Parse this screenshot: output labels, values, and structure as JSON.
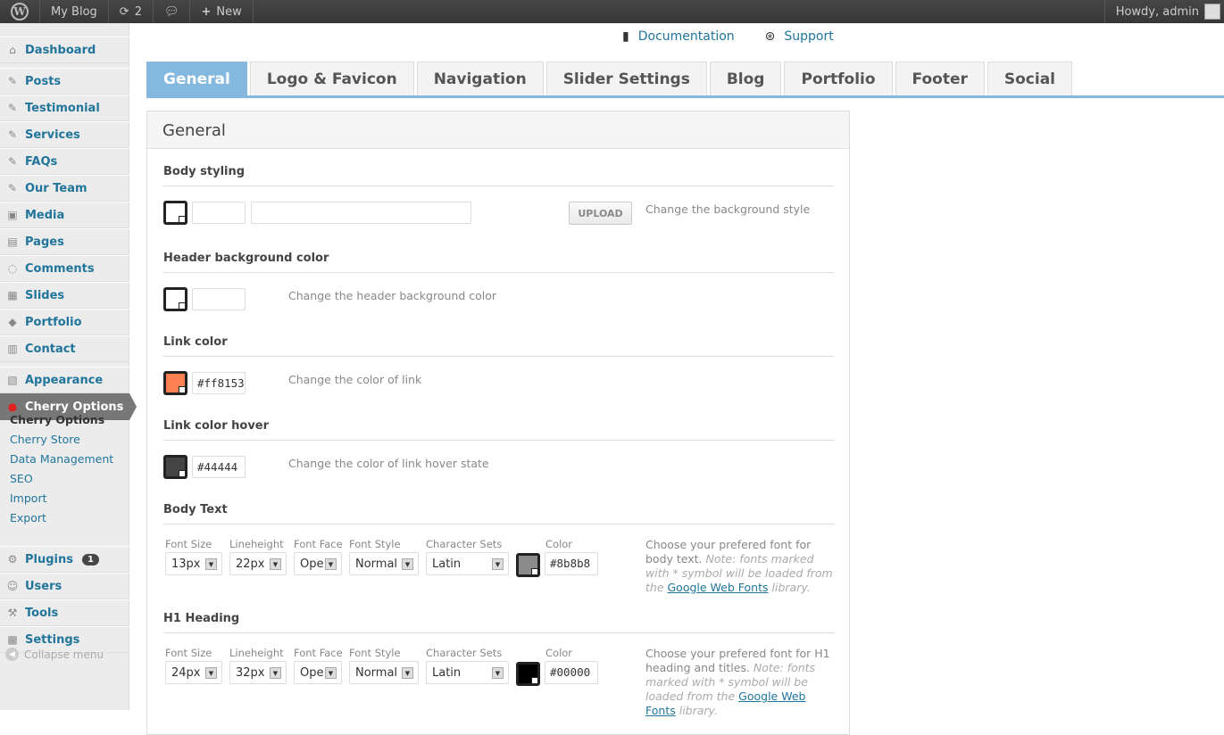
{
  "adminbar": {
    "site": "My Blog",
    "updates": "2",
    "new": "New",
    "howdy": "Howdy, admin"
  },
  "sidebar": {
    "items": [
      {
        "label": "Dashboard",
        "icon": "home-icon"
      },
      {
        "label": "Posts",
        "icon": "pin-icon"
      },
      {
        "label": "Testimonial",
        "icon": "pin-icon"
      },
      {
        "label": "Services",
        "icon": "pin-icon"
      },
      {
        "label": "FAQs",
        "icon": "pin-icon"
      },
      {
        "label": "Our Team",
        "icon": "pin-icon"
      },
      {
        "label": "Media",
        "icon": "media-icon"
      },
      {
        "label": "Pages",
        "icon": "pages-icon"
      },
      {
        "label": "Comments",
        "icon": "comment-icon"
      },
      {
        "label": "Slides",
        "icon": "slides-icon"
      },
      {
        "label": "Portfolio",
        "icon": "portfolio-icon"
      },
      {
        "label": "Contact",
        "icon": "contact-icon"
      },
      {
        "label": "Appearance",
        "icon": "appearance-icon"
      },
      {
        "label": "Cherry Options",
        "icon": "cherry-icon"
      },
      {
        "label": "Plugins",
        "icon": "plugin-icon",
        "badge": "1"
      },
      {
        "label": "Users",
        "icon": "users-icon"
      },
      {
        "label": "Tools",
        "icon": "tools-icon"
      },
      {
        "label": "Settings",
        "icon": "settings-icon"
      }
    ],
    "submenu": [
      "Cherry Options",
      "Cherry Store",
      "Data Management",
      "SEO",
      "Import",
      "Export"
    ],
    "collapse": "Collapse menu"
  },
  "toplinks": {
    "documentation": "Documentation",
    "support": "Support"
  },
  "tabs": [
    "General",
    "Logo & Favicon",
    "Navigation",
    "Slider Settings",
    "Blog",
    "Portfolio",
    "Footer",
    "Social"
  ],
  "panel": {
    "title": "General",
    "body_styling": {
      "heading": "Body styling",
      "upload": "UPLOAD",
      "desc": "Change the background style",
      "color": "",
      "image": ""
    },
    "header_bg": {
      "heading": "Header background color",
      "desc": "Change the header background color",
      "value": ""
    },
    "link_color": {
      "heading": "Link color",
      "value": "#ff8153",
      "desc": "Change the color of link",
      "swatch": "#ff8153"
    },
    "link_hover": {
      "heading": "Link color hover",
      "value": "#44444",
      "desc": "Change the color of link hover state",
      "swatch": "#444444"
    },
    "labels": {
      "size": "Font Size",
      "lh": "Lineheight",
      "face": "Font Face",
      "style": "Font Style",
      "charset": "Character Sets",
      "color": "Color"
    },
    "body_text": {
      "heading": "Body Text",
      "size": "13px",
      "lh": "22px",
      "face": "Ope",
      "style": "Normal",
      "charset": "Latin",
      "color": "#8b8b8",
      "swatch": "#8b8b8b",
      "desc": "Choose your prefered font for body text.",
      "note": "Note: fonts marked with * symbol will be loaded from the",
      "link": "Google Web Fonts",
      "tail": "library."
    },
    "h1": {
      "heading": "H1 Heading",
      "size": "24px",
      "lh": "32px",
      "face": "Ope",
      "style": "Normal",
      "charset": "Latin",
      "color": "#00000",
      "swatch": "#000000",
      "desc": "Choose your prefered font for H1 heading and titles.",
      "note": "Note: fonts marked with * symbol will be loaded from the",
      "link": "Google Web Fonts",
      "tail": "library."
    }
  }
}
